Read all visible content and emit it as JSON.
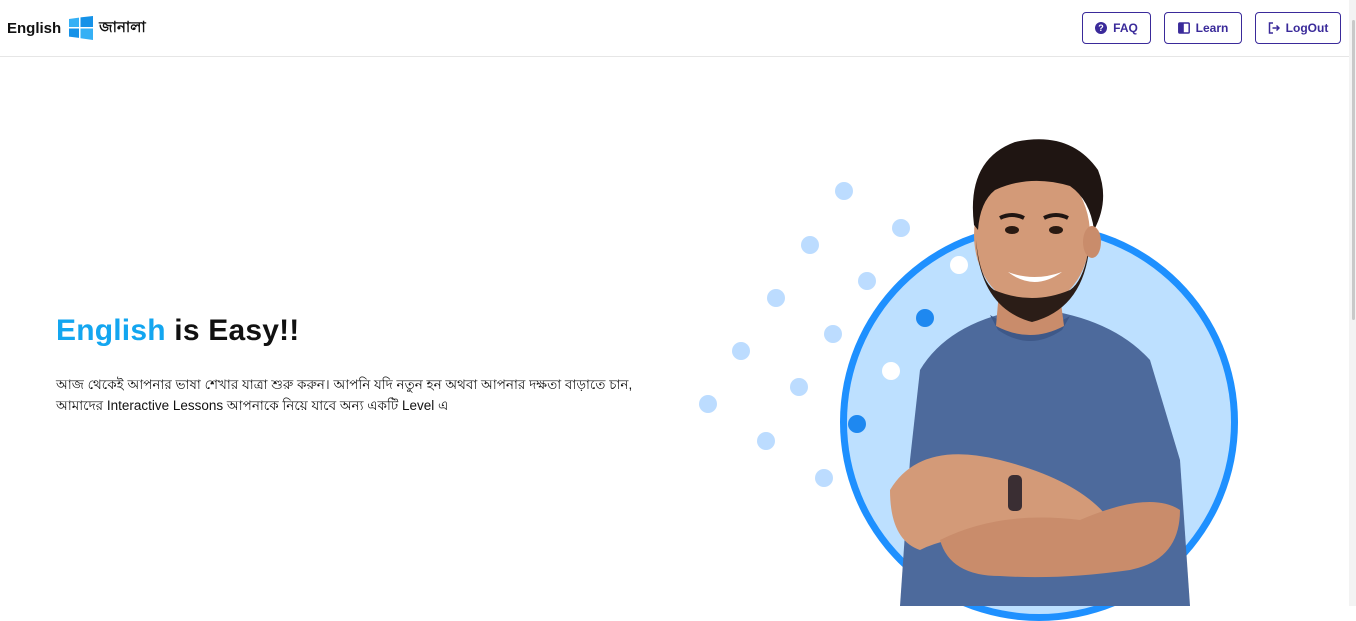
{
  "header": {
    "brand_en": "English",
    "brand_bn": "জানালা",
    "faq_label": "FAQ",
    "learn_label": "Learn",
    "logout_label": "LogOut"
  },
  "hero": {
    "title_accent": "English",
    "title_rest": "is Easy!!",
    "description": "আজ থেকেই আপনার ভাষা শেখার যাত্রা শুরু করুন। আপনি যদি নতুন হন অথবা আপনার দক্ষতা বাড়াতে চান, আমাদের Interactive Lessons আপনাকে নিয়ে যাবে অন্য একটি Level এ"
  },
  "colors": {
    "accent": "#13a6f0",
    "button_border": "#3a2a9a",
    "circle_ring": "#1e90ff",
    "circle_fill": "#bde0ff"
  },
  "icons": {
    "brand": "windows-logo-icon",
    "faq": "question-circle-icon",
    "learn": "book-icon",
    "logout": "logout-icon",
    "hero_image": "smiling-man-arms-crossed"
  }
}
